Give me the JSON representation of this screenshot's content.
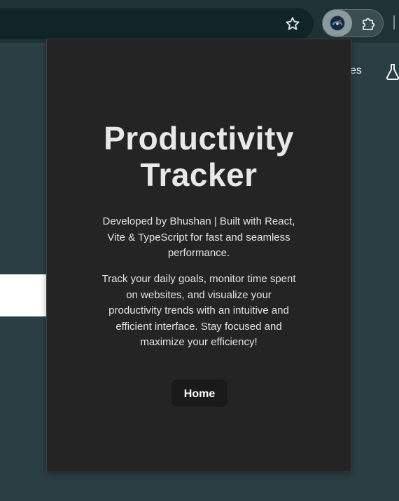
{
  "browser": {
    "toolbar": {
      "bookmark_icon": "star-icon",
      "active_extension_icon": "speedometer-icon",
      "extensions_menu_icon": "puzzle-icon"
    },
    "page": {
      "partial_text": "es",
      "labs_icon": "flask-icon"
    }
  },
  "popup": {
    "title_line1": "Productivity",
    "title_line2": "Tracker",
    "subtitle": "Developed by Bhushan | Built with React, Vite & TypeScript for fast and seamless performance.",
    "description": "Track your daily goals, monitor time spent on websites, and visualize your productivity trends with an intuitive and efficient interface. Stay focused and maximize your efficiency!",
    "home_button_label": "Home"
  },
  "colors": {
    "page_background": "#2a3f44",
    "toolbar_background": "#1f3336",
    "popup_background": "#242424",
    "button_background": "#1a1a1a",
    "text": "#e8e8e8"
  }
}
